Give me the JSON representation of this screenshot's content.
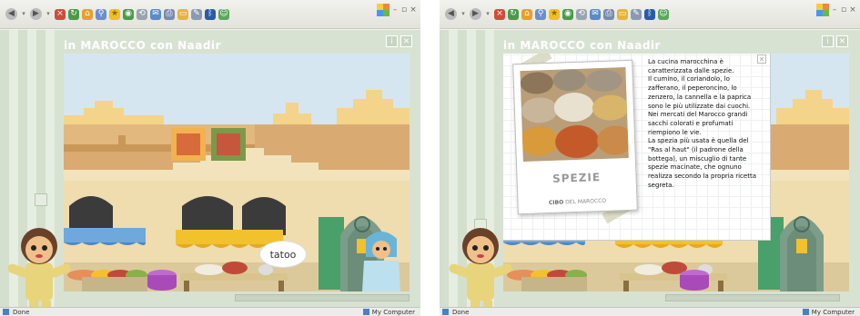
{
  "left": {
    "title": "in MAROCCO con Naadir",
    "info_btn": "i",
    "close_btn": "✕",
    "speech": "tatoo",
    "status": {
      "left": "Done",
      "right": "My Computer"
    }
  },
  "right": {
    "title": "in MAROCCO con Naadir",
    "info_btn": "i",
    "close_btn": "✕",
    "popup": {
      "photo_label": "SPEZIE",
      "photo_caption_bold": "CIBO",
      "photo_caption_rest": " DEL MAROCCO",
      "text": "La cucina marocchina è caratterizzata dalle spezie.\nIl cumino, il coriandolo, lo zafferano, il peperoncino, lo zenzero, la cannella e la paprica sono le più utilizzate dai cuochi.\nNei mercati del Marocco grandi sacchi colorati e profumati riempiono le vie.\nLa spezia più usata è quella del \"Ras al haut\" (il padrone della bottega), un miscuglio di tante spezie macinate, che ognuno realizza secondo la propria ricetta segreta.",
      "close": "✕"
    },
    "status": {
      "left": "Done",
      "right": "My Computer"
    }
  },
  "window_controls": {
    "min": "–",
    "max": "▫",
    "close": "×"
  },
  "toolbar_icons": [
    "back-icon",
    "forward-icon",
    "stop-icon",
    "refresh-icon",
    "home-icon",
    "search-icon",
    "favorites-icon",
    "media-icon",
    "history-icon",
    "mail-icon",
    "print-icon",
    "edit-icon",
    "folder-icon",
    "bluetooth-icon",
    "messenger-icon"
  ],
  "colors": {
    "frame": "#d8e2d2",
    "wall": "#d9ab72",
    "sky": "#d6e6f0",
    "awning_blue": "#6fa8dc",
    "awning_yellow": "#f2c12e",
    "green_door": "#49a06a"
  }
}
